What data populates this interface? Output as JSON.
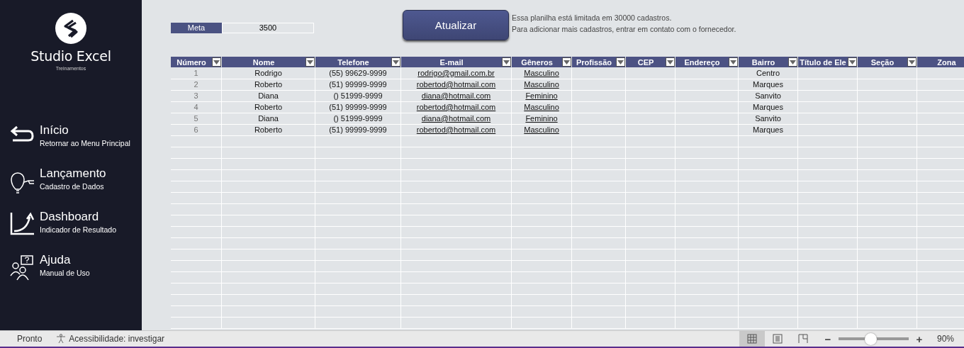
{
  "brand": {
    "name": "Studio Excel",
    "tagline": "Treinamentos"
  },
  "nav": [
    {
      "title": "Início",
      "subtitle": "Retornar ao Menu Principal"
    },
    {
      "title": "Lançamento",
      "subtitle": "Cadastro de Dados"
    },
    {
      "title": "Dashboard",
      "subtitle": "Indicador de Resultado"
    },
    {
      "title": "Ajuda",
      "subtitle": "Manual de Uso"
    }
  ],
  "meta": {
    "label": "Meta",
    "value": "3500"
  },
  "update_button": "Atualizar",
  "notice": [
    "Essa planilha está limitada em 30000 cadastros.",
    "Para adicionar mais cadastros, entrar em contato com o fornecedor."
  ],
  "table": {
    "columns": [
      {
        "label": "Número",
        "kind": "number",
        "filter": true
      },
      {
        "label": "Nome",
        "kind": "text",
        "filter": true
      },
      {
        "label": "Telefone",
        "kind": "text",
        "filter": true
      },
      {
        "label": "E-mail",
        "kind": "link",
        "filter": true
      },
      {
        "label": "Gêneros",
        "kind": "link",
        "filter": true
      },
      {
        "label": "Profissão",
        "kind": "text",
        "filter": true
      },
      {
        "label": "CEP",
        "kind": "text",
        "filter": true
      },
      {
        "label": "Endereço",
        "kind": "text",
        "filter": true
      },
      {
        "label": "Bairro",
        "kind": "text",
        "filter": true
      },
      {
        "label": "Título de Ele",
        "kind": "text",
        "filter": true
      },
      {
        "label": "Seção",
        "kind": "text",
        "filter": true
      },
      {
        "label": "Zona",
        "kind": "text",
        "filter": false
      }
    ],
    "rows": [
      [
        "1",
        "Rodrigo",
        "(55) 99629-9999",
        "rodrigo@gmail.com.br",
        "Masculino",
        "",
        "",
        "",
        "Centro",
        "",
        "",
        ""
      ],
      [
        "2",
        "Roberto",
        "(51) 99999-9999",
        "robertod@hotmail.com",
        "Masculino",
        "",
        "",
        "",
        "Marques",
        "",
        "",
        ""
      ],
      [
        "3",
        "Diana",
        "() 51999-9999",
        "diana@hotmail.com",
        "Feminino",
        "",
        "",
        "",
        "Sanvito",
        "",
        "",
        ""
      ],
      [
        "4",
        "Roberto",
        "(51) 99999-9999",
        "robertod@hotmail.com",
        "Masculino",
        "",
        "",
        "",
        "Marques",
        "",
        "",
        ""
      ],
      [
        "5",
        "Diana",
        "() 51999-9999",
        "diana@hotmail.com",
        "Feminino",
        "",
        "",
        "",
        "Sanvito",
        "",
        "",
        ""
      ],
      [
        "6",
        "Roberto",
        "(51) 99999-9999",
        "robertod@hotmail.com",
        "Masculino",
        "",
        "",
        "",
        "Marques",
        "",
        "",
        ""
      ]
    ]
  },
  "status_bar": {
    "status": "Pronto",
    "accessibility": "Acessibilidade: investigar",
    "views": [
      {
        "selected": true
      },
      {
        "selected": false
      },
      {
        "selected": false
      }
    ],
    "zoom": {
      "minus": "−",
      "level": 0.45,
      "plus": "+",
      "reading": "90%"
    }
  }
}
